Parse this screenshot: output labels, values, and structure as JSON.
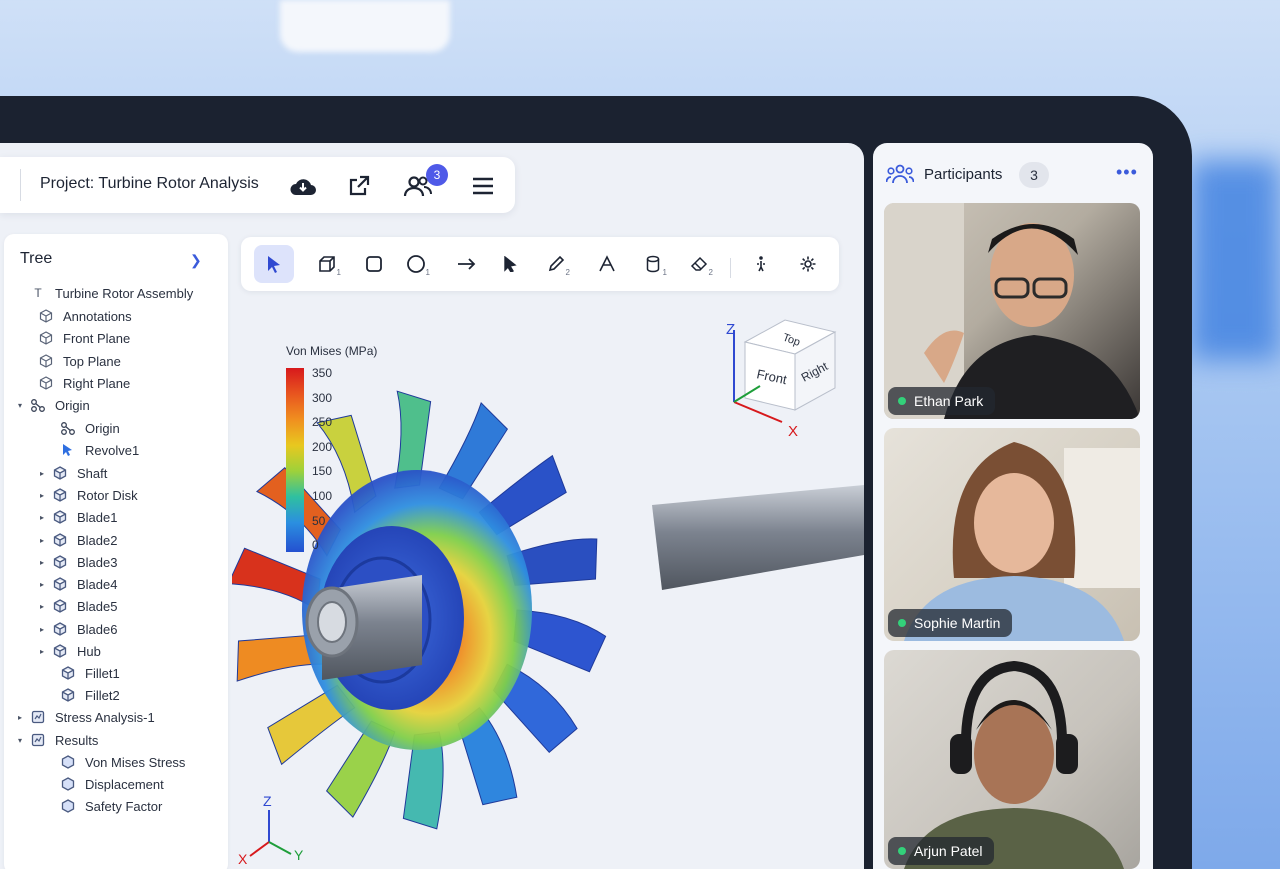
{
  "header": {
    "project_title": "Project: Turbine Rotor Analysis",
    "participants_badge": "3",
    "actions": [
      "cloud-download-icon",
      "share-icon",
      "participants-icon",
      "menu-icon"
    ]
  },
  "tree": {
    "title": "Tree",
    "items": [
      {
        "label": "Turbine Rotor Assembly",
        "icon": "text-icon"
      },
      {
        "label": "Annotations",
        "icon": "cube-icon"
      },
      {
        "label": "Front Plane",
        "icon": "cube-icon"
      },
      {
        "label": "Top Plane",
        "icon": "cube-icon"
      },
      {
        "label": "Right Plane",
        "icon": "cube-icon"
      },
      {
        "label": "Origin",
        "icon": "origin-icon"
      },
      {
        "label": "Origin",
        "icon": "origin-icon"
      },
      {
        "label": "Revolve1",
        "icon": "revolve-icon"
      },
      {
        "label": "Shaft",
        "icon": "part-icon"
      },
      {
        "label": "Rotor Disk",
        "icon": "part-icon"
      },
      {
        "label": "Blade1",
        "icon": "part-icon"
      },
      {
        "label": "Blade2",
        "icon": "part-icon"
      },
      {
        "label": "Blade3",
        "icon": "part-icon"
      },
      {
        "label": "Blade4",
        "icon": "part-icon"
      },
      {
        "label": "Blade5",
        "icon": "part-icon"
      },
      {
        "label": "Blade6",
        "icon": "part-icon"
      },
      {
        "label": "Hub",
        "icon": "part-icon"
      },
      {
        "label": "Fillet1",
        "icon": "part-icon"
      },
      {
        "label": "Fillet2",
        "icon": "part-icon"
      },
      {
        "label": "Stress Analysis-1",
        "icon": "study-icon"
      },
      {
        "label": "Results",
        "icon": "study-icon"
      },
      {
        "label": "Von Mises Stress",
        "icon": "result-icon"
      },
      {
        "label": "Displacement",
        "icon": "result-icon"
      },
      {
        "label": "Safety Factor",
        "icon": "result-icon"
      }
    ]
  },
  "toolbar": {
    "tools": [
      "select-icon",
      "box-icon",
      "rectangle-icon",
      "circle-icon",
      "arrow-icon",
      "pointer-icon",
      "pencil-icon",
      "text-tool-icon",
      "cylinder-icon",
      "eraser-icon",
      "gesture-icon",
      "settings-icon"
    ],
    "subscripts": {
      "box": "1",
      "circle": "1",
      "pencil": "2",
      "cylinder": "1",
      "eraser": "2"
    }
  },
  "legend": {
    "title": "Von Mises (MPa)",
    "ticks": [
      "350",
      "300",
      "250",
      "200",
      "150",
      "100",
      "50",
      "0"
    ]
  },
  "viewcube": {
    "top": "Top",
    "front": "Front",
    "right": "Right"
  },
  "axes": {
    "z": "Z",
    "x": "X",
    "y": "Y"
  },
  "participants": {
    "title": "Participants",
    "count": "3",
    "people": [
      {
        "name": "Ethan Park",
        "status": "online"
      },
      {
        "name": "Sophie Martin",
        "status": "online"
      },
      {
        "name": "Arjun Patel",
        "status": "online"
      }
    ]
  },
  "colors": {
    "accent": "#4f5ae8",
    "online": "#33d17a",
    "link": "#3b5bdb"
  }
}
